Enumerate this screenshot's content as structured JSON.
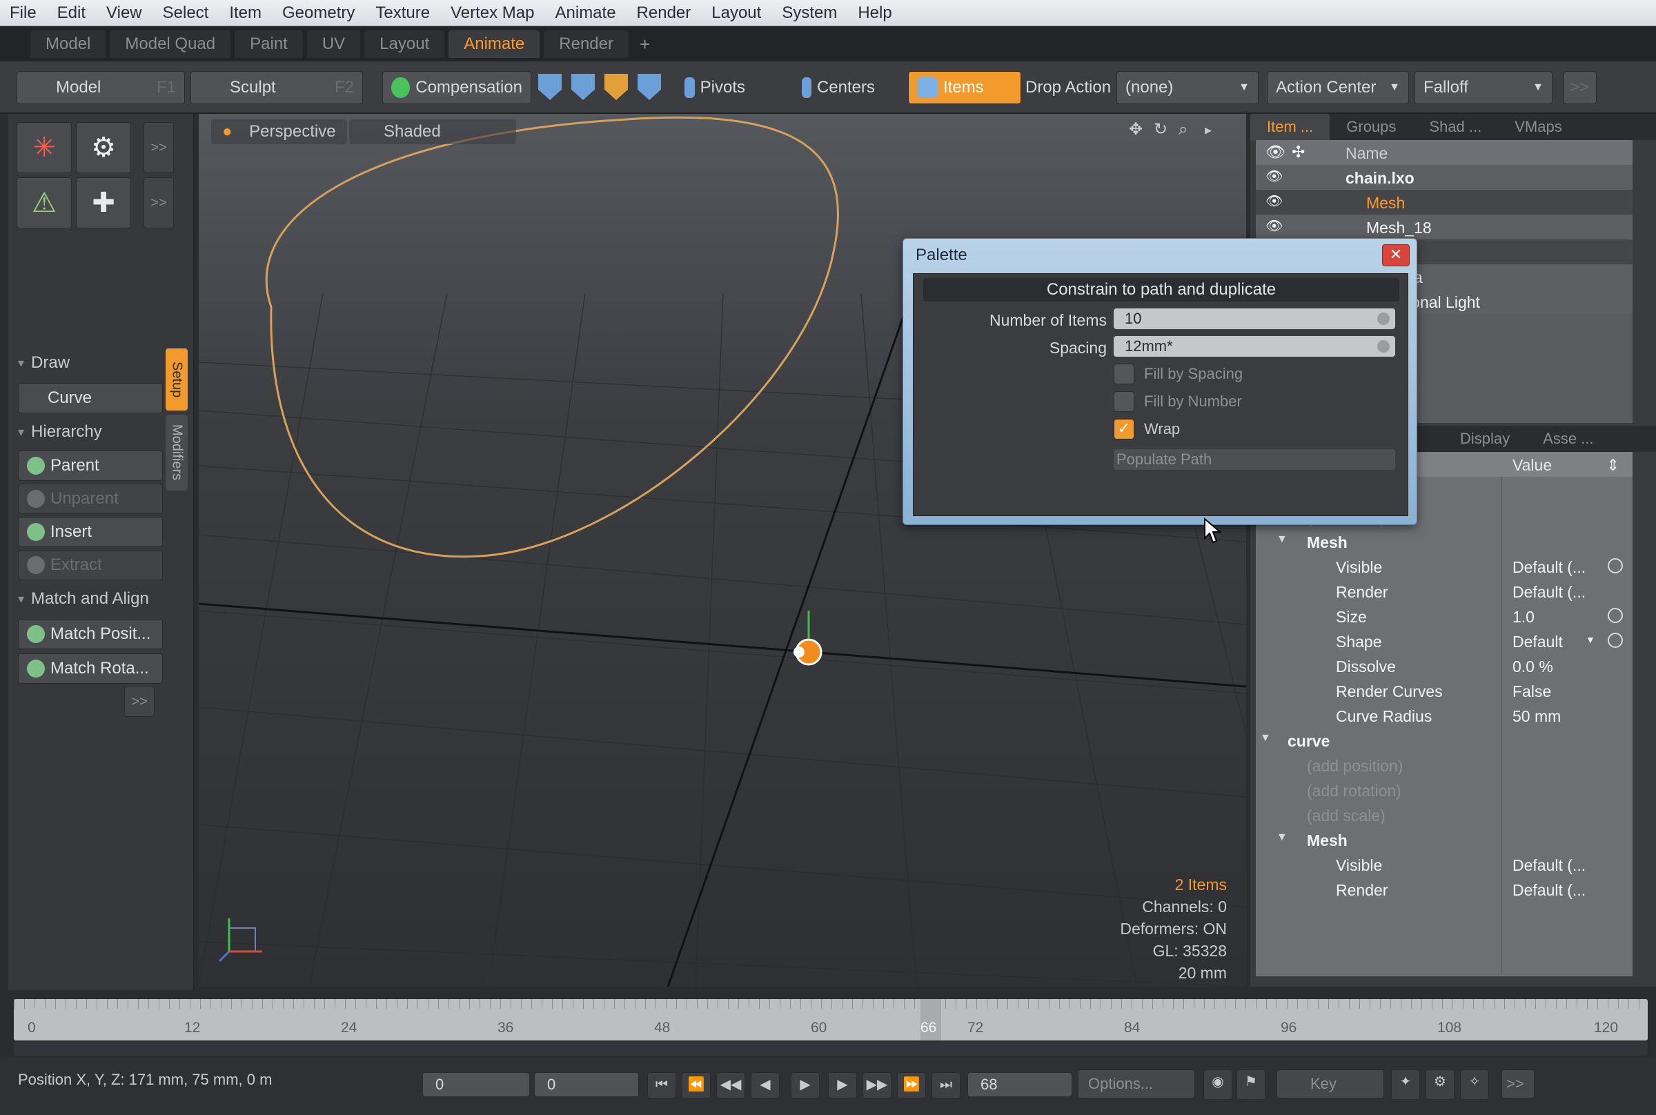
{
  "menubar": [
    "File",
    "Edit",
    "View",
    "Select",
    "Item",
    "Geometry",
    "Texture",
    "Vertex Map",
    "Animate",
    "Render",
    "Layout",
    "System",
    "Help"
  ],
  "layout_tabs": {
    "items": [
      "Model",
      "Model Quad",
      "Paint",
      "UV",
      "Layout",
      "Animate",
      "Render"
    ],
    "active": "Animate",
    "add": "+"
  },
  "toolbar": {
    "model": "Model",
    "model_key": "F1",
    "sculpt": "Sculpt",
    "sculpt_key": "F2",
    "compensation": "Compensation",
    "pivots": "Pivots",
    "centers": "Centers",
    "items": "Items",
    "drop_action_label": "Drop Action",
    "drop_action_value": "(none)",
    "action_center": "Action Center",
    "falloff": "Falloff",
    "more": ">>"
  },
  "left_panel": {
    "more": ">>",
    "draw_header": "Draw",
    "curve": "Curve",
    "hierarchy_header": "Hierarchy",
    "parent": "Parent",
    "unparent": "Unparent",
    "insert": "Insert",
    "extract": "Extract",
    "match_header": "Match and Align",
    "match_position": "Match Posit...",
    "match_rotation": "Match Rota...",
    "tab_setup": "Setup",
    "tab_modifiers": "Modifiers"
  },
  "viewport": {
    "view_mode": "Perspective",
    "shading": "Shaded",
    "info": {
      "items": "2 Items",
      "channels": "Channels: 0",
      "deformers": "Deformers: ON",
      "gl": "GL: 35328",
      "grid": "20 mm"
    }
  },
  "item_list": {
    "tabs": [
      "Item ...",
      "Groups",
      "Shad ...",
      "VMaps"
    ],
    "header": "Name",
    "rows": [
      "chain.lxo",
      "Mesh",
      "Mesh_18",
      "curve",
      "Camera",
      "Directional Light"
    ]
  },
  "properties": {
    "tabs": [
      "Display",
      "Asse ..."
    ],
    "value_header": "Value",
    "rows": [
      {
        "name": "(add rotation)",
        "value": "",
        "dim": true,
        "indent": 1
      },
      {
        "name": "(add scale)",
        "value": "",
        "dim": true,
        "indent": 1
      },
      {
        "name": "Mesh",
        "value": "",
        "bold": true,
        "indent": 1,
        "expand": "▼"
      },
      {
        "name": "Visible",
        "value": "Default (...",
        "indent": 2,
        "radio": true
      },
      {
        "name": "Render",
        "value": "Default (...",
        "indent": 2
      },
      {
        "name": "Size",
        "value": "1.0",
        "indent": 2,
        "radio": true
      },
      {
        "name": "Shape",
        "value": "Default",
        "indent": 2,
        "radio": true,
        "dropdown": true
      },
      {
        "name": "Dissolve",
        "value": "0.0 %",
        "indent": 2
      },
      {
        "name": "Render Curves",
        "value": "False",
        "indent": 2
      },
      {
        "name": "Curve Radius",
        "value": "50 mm",
        "indent": 2
      },
      {
        "name": "curve",
        "value": "",
        "bold": true,
        "indent": 0,
        "expand": "▼"
      },
      {
        "name": "(add position)",
        "value": "",
        "dim": true,
        "indent": 1
      },
      {
        "name": "(add rotation)",
        "value": "",
        "dim": true,
        "indent": 1
      },
      {
        "name": "(add scale)",
        "value": "",
        "dim": true,
        "indent": 1
      },
      {
        "name": "Mesh",
        "value": "",
        "bold": true,
        "indent": 1,
        "expand": "▼"
      },
      {
        "name": "Visible",
        "value": "Default (...",
        "indent": 2
      },
      {
        "name": "Render",
        "value": "Default (...",
        "indent": 2
      }
    ]
  },
  "palette": {
    "title": "Palette",
    "close": "✕",
    "heading": "Constrain to path and duplicate",
    "number_label": "Number of Items",
    "number_value": "10",
    "spacing_label": "Spacing",
    "spacing_value": "12mm*",
    "fill_spacing": "Fill by Spacing",
    "fill_number": "Fill by Number",
    "wrap": "Wrap",
    "populate": "Populate Path"
  },
  "timeline": {
    "ticks": [
      "0",
      "12",
      "24",
      "36",
      "48",
      "60",
      "72",
      "84",
      "96",
      "108",
      "120"
    ],
    "current_frame": "66"
  },
  "bottom": {
    "position": "Position X, Y, Z:  171 mm, 75 mm, 0 m",
    "start": "0",
    "current": "0",
    "end": "68",
    "options": "Options...",
    "key": "Key",
    "more": ">>"
  },
  "colors": {
    "accent": "#f39a2c",
    "selection": "#ff9a2a",
    "curve": "#d7a15a"
  }
}
